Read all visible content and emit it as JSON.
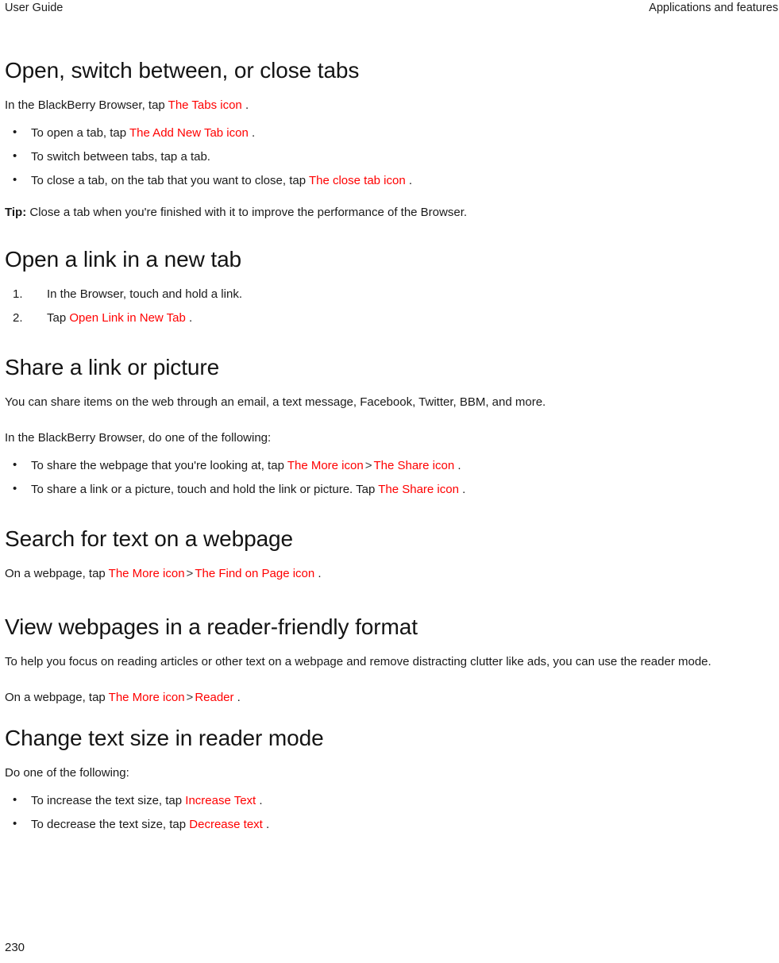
{
  "header": {
    "left": "User Guide",
    "right": "Applications and features"
  },
  "colors": {
    "ui_link": "#ff0000",
    "text": "#1a1a1a",
    "background": "#ffffff"
  },
  "sections": [
    {
      "id": "open-switch-close-tabs",
      "title": "Open, switch between, or close tabs",
      "intro_before": "In the BlackBerry Browser, tap ",
      "intro_link": "The Tabs icon",
      "intro_after": " .",
      "bullets": [
        {
          "before": "To open a tab, tap ",
          "link": "The Add New Tab icon",
          "after": " ."
        },
        {
          "before": " To switch between tabs, tap a tab.",
          "link": "",
          "after": ""
        },
        {
          "before": "To close a tab, on the tab that you want to close, tap ",
          "link": "The close tab icon",
          "after": " ."
        }
      ],
      "tip_label": "Tip:",
      "tip_text": " Close a tab when you're finished with it to improve the performance of the Browser."
    },
    {
      "id": "open-link-new-tab",
      "title": "Open a link in a new tab",
      "steps": [
        {
          "num": "1.",
          "before": "In the Browser, touch and hold a link.",
          "link": "",
          "after": ""
        },
        {
          "num": "2.",
          "before": "Tap ",
          "link": "Open Link in New Tab",
          "after": " ."
        }
      ]
    },
    {
      "id": "share-link-or-picture",
      "title": "Share a link or picture",
      "para1": "You can share items on the web through an email, a text message, Facebook, Twitter, BBM, and more.",
      "para2": "In the BlackBerry Browser, do one of the following:",
      "bullets": [
        {
          "before": "To share the webpage that you're looking at, tap ",
          "link": "The More icon",
          "sep": ">",
          "link2": "The Share icon",
          "after": " ."
        },
        {
          "before": "To share a link or a picture, touch and hold the link or picture. Tap ",
          "link": "The Share icon",
          "sep": "",
          "link2": "",
          "after": " ."
        }
      ]
    },
    {
      "id": "search-text-webpage",
      "title": "Search for text on a webpage",
      "line": {
        "before": "On a webpage, tap ",
        "link": "The More icon",
        "sep": ">",
        "link2": "The Find on Page icon",
        "after": " ."
      }
    },
    {
      "id": "reader-friendly-format",
      "title": "View webpages in a reader-friendly format",
      "para1": "To help you focus on reading articles or other text on a webpage and remove distracting clutter like ads, you can use the reader mode.",
      "line": {
        "before": "On a webpage, tap ",
        "link": "The More icon",
        "sep": ">",
        "link2": "Reader",
        "after": " ."
      }
    },
    {
      "id": "change-text-size-reader",
      "title": "Change text size in reader mode",
      "para1": "Do one of the following:",
      "bullets": [
        {
          "before": "To increase the text size, tap ",
          "link": "Increase Text",
          "after": " ."
        },
        {
          "before": "To decrease the text size, tap ",
          "link": "Decrease text",
          "after": " ."
        }
      ]
    }
  ],
  "footer": {
    "page_number": "230"
  }
}
